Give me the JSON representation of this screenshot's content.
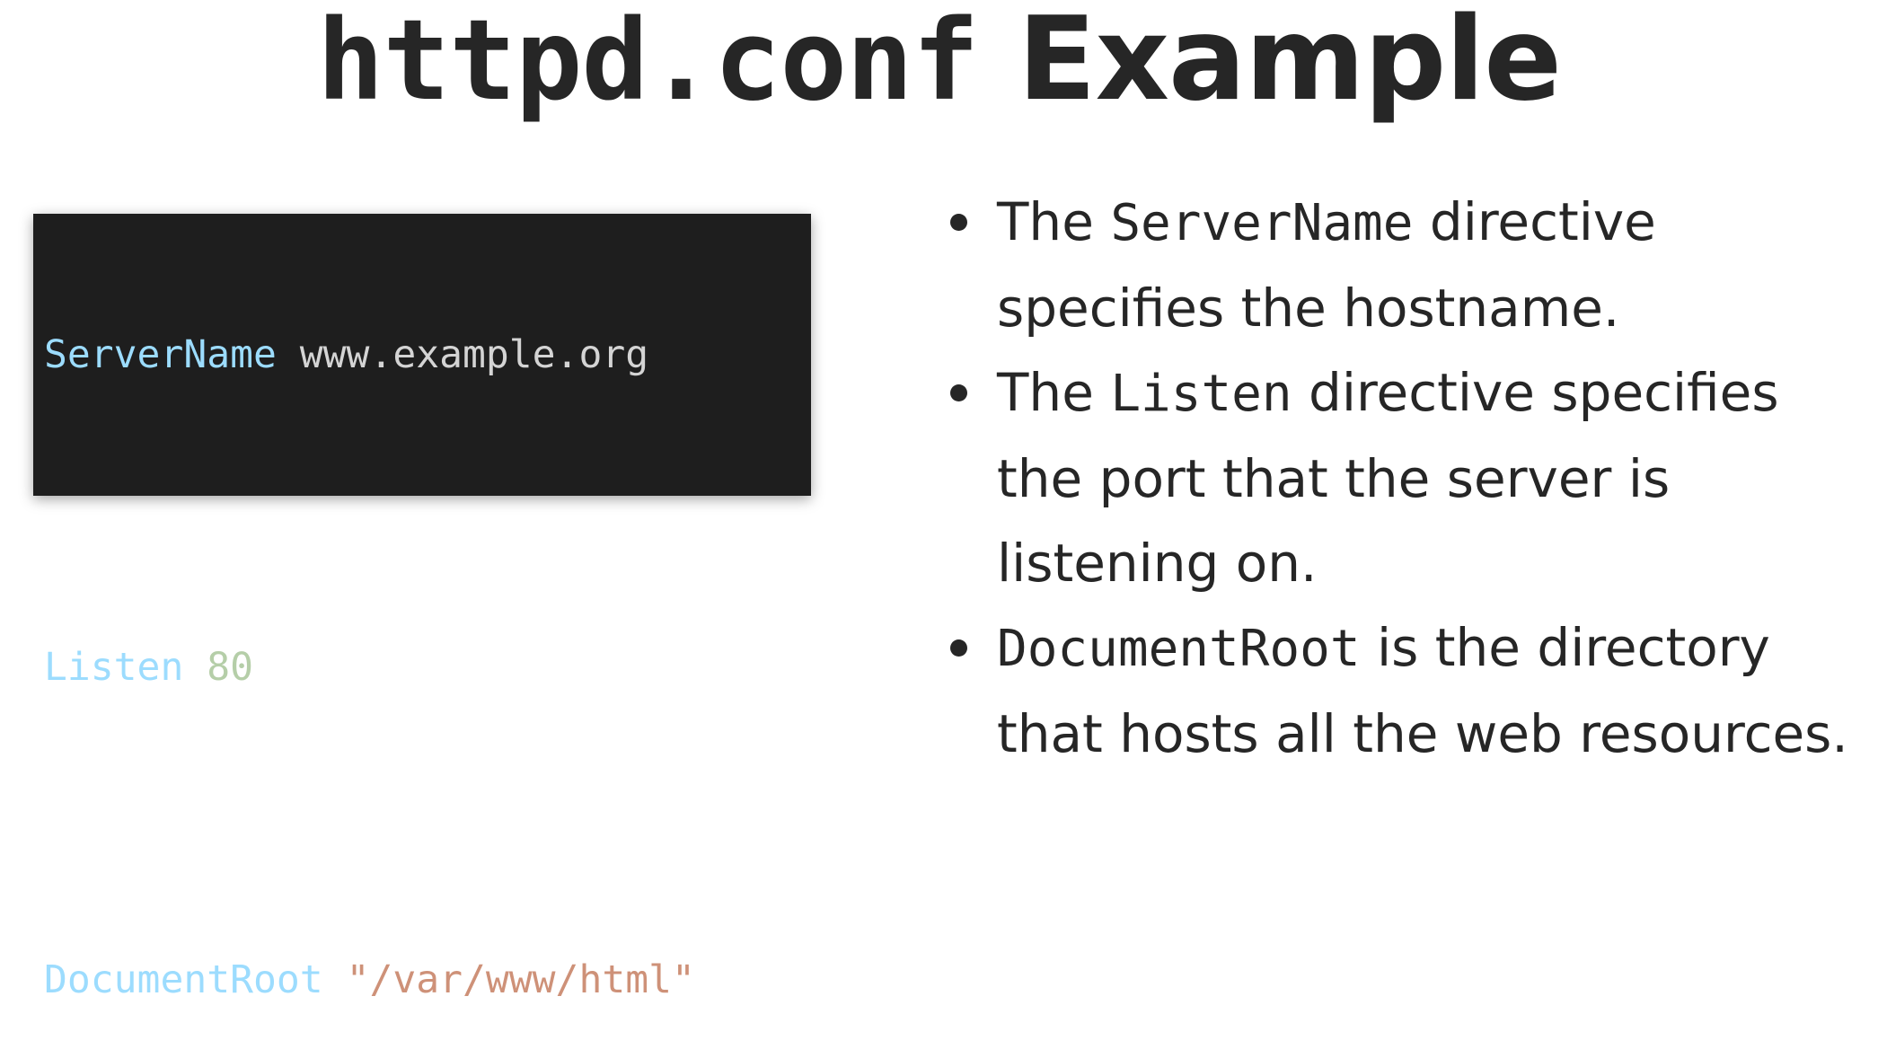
{
  "title": {
    "code_part": "httpd.conf",
    "text_part": "Example"
  },
  "code_block": {
    "lines": [
      {
        "directive": "ServerName",
        "value": "www.example.org",
        "value_type": "plain"
      },
      {
        "directive": "Listen",
        "value": "80",
        "value_type": "number"
      },
      {
        "directive": "DocumentRoot",
        "value": "\"/var/www/html\"",
        "value_type": "string"
      }
    ],
    "colors": {
      "background": "#1e1e1e",
      "directive": "#9cdcfe",
      "plain": "#d4d4d4",
      "number": "#b5cea8",
      "string": "#ce9178"
    }
  },
  "bullets": [
    {
      "before": "The ",
      "code": "ServerName",
      "after": " directive specifies the hostname."
    },
    {
      "before": "The ",
      "code": "Listen",
      "after": " directive specifies the port that the server is listening on."
    },
    {
      "before": "",
      "code": "DocumentRoot",
      "after": " is the directory that hosts all the web resources."
    }
  ]
}
